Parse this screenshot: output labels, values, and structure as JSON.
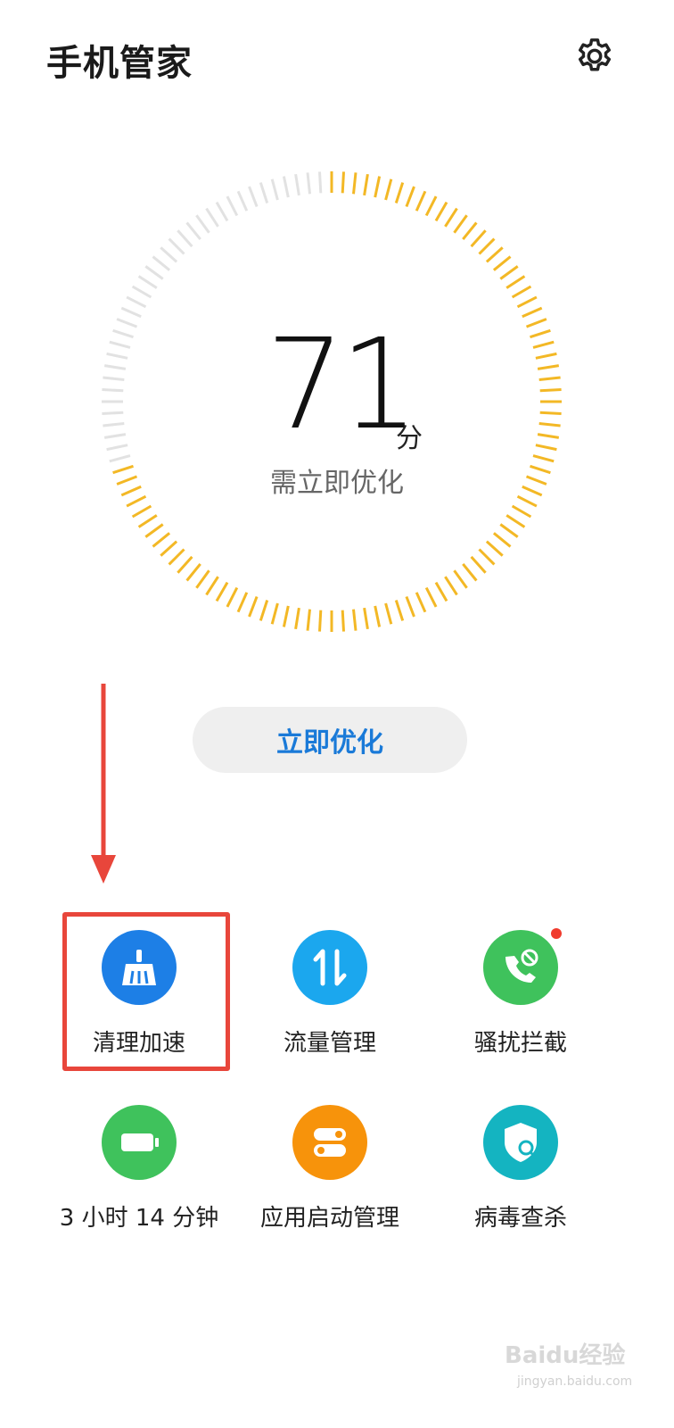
{
  "header": {
    "title": "手机管家",
    "settings_icon": "gear-icon"
  },
  "score": {
    "value": "71",
    "unit": "分",
    "status": "需立即优化",
    "fraction": 0.71,
    "colors": {
      "active": "#f3b825",
      "inactive": "#e2e2e2"
    }
  },
  "optimize_button": {
    "label": "立即优化",
    "color": "#1a7ad8"
  },
  "tools": [
    {
      "label": "清理加速",
      "icon": "broom-icon",
      "color": "#1d7fe6"
    },
    {
      "label": "流量管理",
      "icon": "data-transfer-icon",
      "color": "#1ba7ee"
    },
    {
      "label": "骚扰拦截",
      "icon": "phone-block-icon",
      "color": "#3fc25c"
    },
    {
      "label": "3 小时 14 分钟",
      "icon": "battery-icon",
      "color": "#3fc25c"
    },
    {
      "label": "应用启动管理",
      "icon": "app-launch-icon",
      "color": "#f7930b"
    },
    {
      "label": "病毒查杀",
      "icon": "shield-scan-icon",
      "color": "#14b4c1"
    }
  ],
  "annotation": {
    "color": "#e8463b"
  },
  "watermark": {
    "text": "Baidu经验",
    "url_text": "jingyan.baidu.com"
  }
}
